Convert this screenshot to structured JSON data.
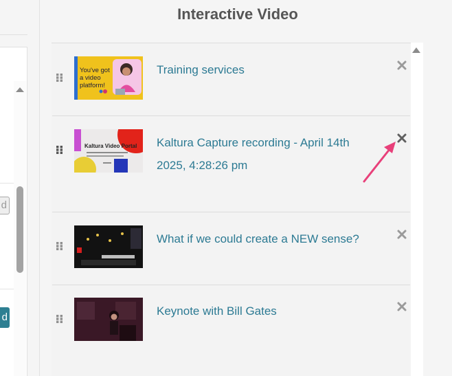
{
  "panel": {
    "title": "Interactive Video"
  },
  "left_panel": {
    "chip_grey_text": "d",
    "chip_teal_text": "d"
  },
  "items": [
    {
      "title": "Training services"
    },
    {
      "title": "Kaltura Capture recording - April 14th 2025, 4:28:26 pm",
      "thumb_text": "Kaltura Video Portal"
    },
    {
      "title": "What if we could create a NEW sense?"
    },
    {
      "title": "Keynote with Bill Gates"
    }
  ],
  "icons": {
    "search": "search-icon",
    "drag": "drag-handle-icon",
    "remove": "close-icon",
    "annotation": "arrow-annotation-icon"
  },
  "colors": {
    "accent": "#2c7a93",
    "teal_button": "#2e7f92",
    "annotation_arrow": "#e8407a",
    "title_text": "#555555"
  }
}
